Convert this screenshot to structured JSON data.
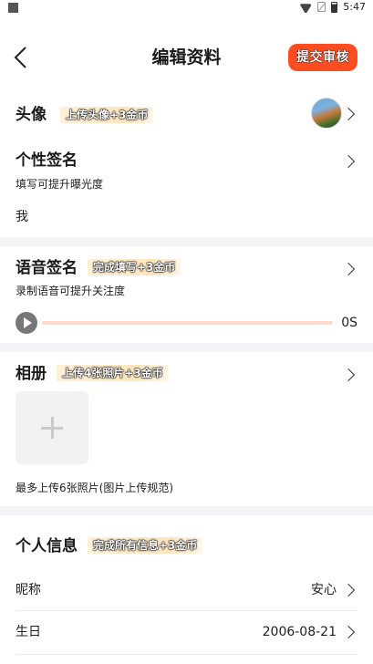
{
  "status_bar": {
    "time": "5:47"
  },
  "header": {
    "title": "编辑资料",
    "submit_label": "提交审核"
  },
  "avatar_row": {
    "label": "头像",
    "reward": "上传头像+3金币"
  },
  "signature": {
    "label": "个性签名",
    "hint": "填写可提升曝光度",
    "value": "我"
  },
  "voice_signature": {
    "label": "语音签名",
    "reward": "完成填写+3金币",
    "hint": "录制语音可提升关注度",
    "duration": "0S"
  },
  "album": {
    "label": "相册",
    "reward": "上传4张照片+3金币",
    "note": "最多上传6张照片(图片上传规范)"
  },
  "personal_info": {
    "label": "个人信息",
    "reward": "完成所有信息+3金币",
    "fields": [
      {
        "label": "昵称",
        "value": "安心"
      },
      {
        "label": "生日",
        "value": "2006-08-21"
      }
    ]
  }
}
